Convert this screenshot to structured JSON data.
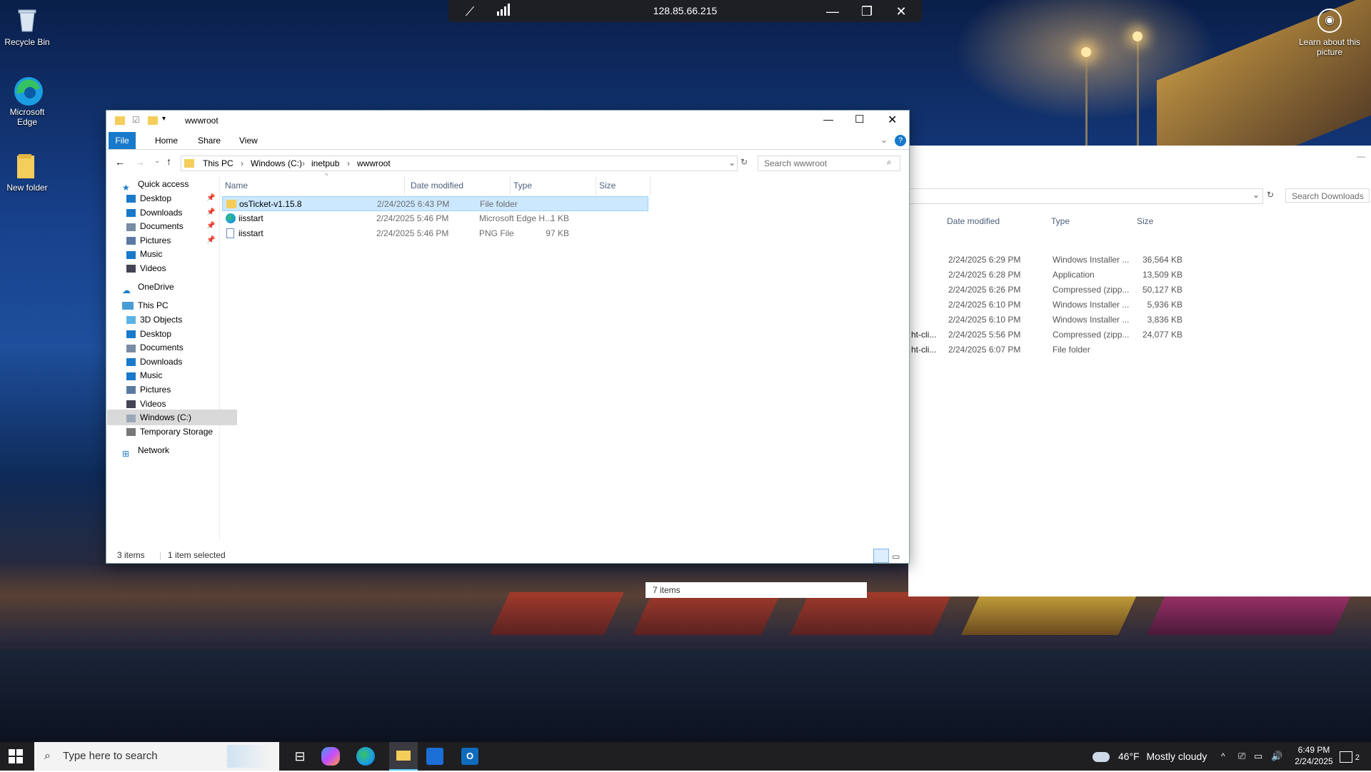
{
  "desktop": {
    "icons": [
      {
        "label": "Recycle Bin"
      },
      {
        "label": "Microsoft Edge"
      },
      {
        "label": "New folder"
      }
    ],
    "learn_about": "Learn about this picture"
  },
  "remote_bar": {
    "address": "128.85.66.215"
  },
  "back_window": {
    "search_placeholder": "Search Downloads",
    "columns": [
      "Date modified",
      "Type",
      "Size"
    ],
    "rows": [
      {
        "name": "",
        "date": "2/24/2025 6:29 PM",
        "type": "Windows Installer ...",
        "size": "36,564 KB"
      },
      {
        "name": "",
        "date": "2/24/2025 6:28 PM",
        "type": "Application",
        "size": "13,509 KB"
      },
      {
        "name": "",
        "date": "2/24/2025 6:26 PM",
        "type": "Compressed (zipp...",
        "size": "50,127 KB"
      },
      {
        "name": "",
        "date": "2/24/2025 6:10 PM",
        "type": "Windows Installer ...",
        "size": "5,936 KB"
      },
      {
        "name": "",
        "date": "2/24/2025 6:10 PM",
        "type": "Windows Installer ...",
        "size": "3,836 KB"
      },
      {
        "name": "ht-cli...",
        "date": "2/24/2025 5:56 PM",
        "type": "Compressed (zipp...",
        "size": "24,077 KB"
      },
      {
        "name": "ht-cli...",
        "date": "2/24/2025 6:07 PM",
        "type": "File folder",
        "size": ""
      }
    ],
    "status": "7 items"
  },
  "explorer": {
    "title": "wwwroot",
    "tabs": [
      "File",
      "Home",
      "Share",
      "View"
    ],
    "breadcrumb": [
      "This PC",
      "Windows (C:)",
      "inetpub",
      "wwwroot"
    ],
    "search_placeholder": "Search wwwroot",
    "nav": {
      "quick_access": "Quick access",
      "quick_items": [
        "Desktop",
        "Downloads",
        "Documents",
        "Pictures",
        "Music",
        "Videos"
      ],
      "onedrive": "OneDrive",
      "this_pc": "This PC",
      "pc_items": [
        "3D Objects",
        "Desktop",
        "Documents",
        "Downloads",
        "Music",
        "Pictures",
        "Videos",
        "Windows (C:)",
        "Temporary Storage"
      ],
      "network": "Network"
    },
    "columns": [
      "Name",
      "Date modified",
      "Type",
      "Size"
    ],
    "files": [
      {
        "name": "osTicket-v1.15.8",
        "date": "2/24/2025 6:43 PM",
        "type": "File folder",
        "size": "",
        "icon": "folder-icon",
        "selected": true
      },
      {
        "name": "iisstart",
        "date": "2/24/2025 5:46 PM",
        "type": "Microsoft Edge H...",
        "size": "1 KB",
        "icon": "edge-html-icon",
        "selected": false
      },
      {
        "name": "iisstart",
        "date": "2/24/2025 5:46 PM",
        "type": "PNG File",
        "size": "97 KB",
        "icon": "png-icon",
        "selected": false
      }
    ],
    "status_items": "3 items",
    "status_selected": "1 item selected"
  },
  "taskbar": {
    "search_placeholder": "Type here to search",
    "weather_temp": "46°F",
    "weather_desc": "Mostly cloudy",
    "time": "6:49 PM",
    "date": "2/24/2025",
    "notification_count": "2"
  }
}
